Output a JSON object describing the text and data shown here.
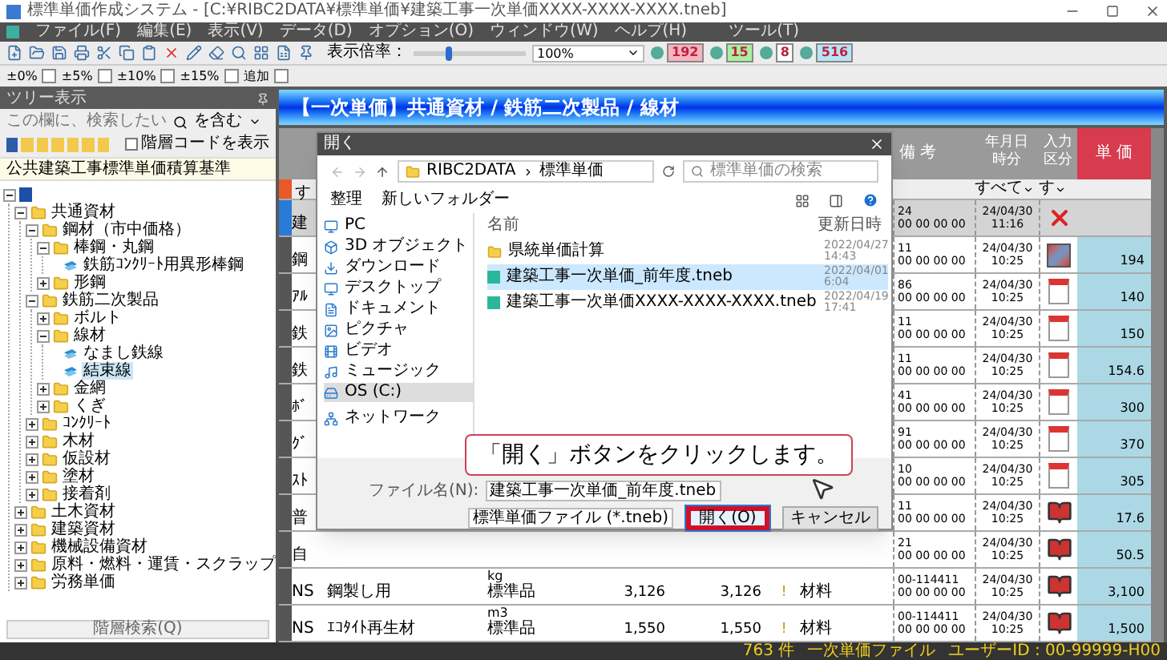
{
  "window": {
    "title": "標準単価作成システム - [C:¥RIBC2DATA¥標準単価¥建築工事一次単価XXXX-XXXX-XXXX.tneb]"
  },
  "menu": [
    "ファイル(F)",
    "編集(E)",
    "表示(V)",
    "データ(D)",
    "オプション(O)",
    "ウィンドウ(W)",
    "ヘルプ(H)",
    "ツール(T)"
  ],
  "toolbar": {
    "zoom_label": "表示倍率：",
    "zoom": {
      "level": 0.3
    },
    "zoom_value": "100%",
    "counters": [
      {
        "value": "192",
        "color": "#f6b3c0"
      },
      {
        "value": "15",
        "color": "#a8f0a0"
      },
      {
        "value": "8",
        "color": "#ffffff"
      },
      {
        "value": "516",
        "color": "#b8e4f8"
      }
    ]
  },
  "percent_bar": [
    "±0%",
    "±5%",
    "±10%",
    "±15%",
    "追加"
  ],
  "tree_panel": {
    "title": "ツリー表示",
    "search_placeholder": "この欄に、検索したい",
    "match_mode": "を含む",
    "show_code": {
      "label": "階層コードを表示",
      "checked": false
    },
    "standard": "公共建築工事標準単価積算基準",
    "tree": [
      {
        "expanded": true,
        "children": [
          {
            "label": "共通資材",
            "expanded": true,
            "children": [
              {
                "label": "鋼材（市中価格）",
                "expanded": true,
                "children": [
                  {
                    "label": "棒鋼・丸鋼",
                    "expanded": true,
                    "children": [
                      {
                        "label": "鉄筋ｺﾝｸﾘｰﾄ用異形棒鋼",
                        "selected": false
                      }
                    ]
                  },
                  {
                    "label": "形鋼",
                    "expanded": false
                  }
                ]
              },
              {
                "label": "鉄筋二次製品",
                "expanded": true,
                "children": [
                  {
                    "label": "ボルト",
                    "expanded": false
                  },
                  {
                    "label": "線材",
                    "expanded": true,
                    "children": [
                      {
                        "label": "なまし鉄線",
                        "selected": false
                      },
                      {
                        "label": "結束線",
                        "selected": true
                      }
                    ]
                  },
                  {
                    "label": "金網",
                    "expanded": false
                  },
                  {
                    "label": "くぎ",
                    "expanded": false
                  }
                ]
              },
              {
                "label": "ｺﾝｸﾘｰﾄ",
                "expanded": false
              },
              {
                "label": "木材",
                "expanded": false
              },
              {
                "label": "仮設材",
                "expanded": false
              },
              {
                "label": "塗材",
                "expanded": false
              },
              {
                "label": "接着剤",
                "expanded": false
              }
            ]
          },
          {
            "label": "土木資材",
            "expanded": false
          },
          {
            "label": "建築資材",
            "expanded": false
          },
          {
            "label": "機械設備資材",
            "expanded": false
          },
          {
            "label": "原料・燃料・運賃・スクラップ",
            "expanded": false
          },
          {
            "label": "労務単価",
            "expanded": false
          }
        ]
      }
    ],
    "search_button": "階層検索(Q)"
  },
  "banner": "【一次単価】共通資材 / 鉄筋二次製品 / 線材",
  "grid": {
    "headers": [
      [
        "備 考"
      ],
      [
        "年月日",
        "時分"
      ],
      [
        "入力",
        "区分"
      ],
      [
        "単 価"
      ]
    ],
    "filters": [
      "す",
      "すべて",
      "す"
    ],
    "rows": [
      {
        "name": "建",
        "code": "24",
        "remarks": "00 00 00 00",
        "date": "24/04/30",
        "time": "11:16",
        "kind": "deleted",
        "selected": true
      },
      {
        "name": "鋼",
        "code": "11",
        "remarks": "00 00 00 00",
        "date": "24/04/30",
        "time": "10:25",
        "kind": "edited",
        "price": "194",
        "selected": false
      },
      {
        "name": "ｱﾙ",
        "code": "86",
        "remarks": "00 00 00 00",
        "date": "24/04/30",
        "time": "10:25",
        "kind": "document",
        "price": "140",
        "selected": false
      },
      {
        "name": "鉄",
        "code": "11",
        "remarks": "00 00 00 00",
        "date": "24/04/30",
        "time": "10:25",
        "kind": "document",
        "price": "150",
        "selected": false
      },
      {
        "name": "鉄",
        "code": "11",
        "remarks": "00 00 00 00",
        "date": "24/04/30",
        "time": "10:25",
        "kind": "document",
        "price": "154.6",
        "selected": false
      },
      {
        "name": "ﾎﾞ",
        "code": "41",
        "remarks": "00 00 00 00",
        "date": "24/04/30",
        "time": "10:25",
        "kind": "document",
        "price": "300",
        "selected": false
      },
      {
        "name": "ｸﾞ",
        "code": "91",
        "remarks": "00 00 00 00",
        "date": "24/04/30",
        "time": "10:25",
        "kind": "document",
        "price": "370",
        "selected": false
      },
      {
        "name": "ｽﾄ",
        "code": "10",
        "remarks": "00 00 00 00",
        "date": "24/04/30",
        "time": "10:25",
        "kind": "document",
        "price": "305",
        "selected": false
      },
      {
        "name": "普",
        "code": "11",
        "remarks": "00 00 00 00",
        "date": "24/04/30",
        "time": "10:25",
        "kind": "book",
        "price": "17.6",
        "selected": false
      },
      {
        "name": "自",
        "code": "21",
        "remarks": "00 00 00 00",
        "date": "24/04/30",
        "time": "10:25",
        "kind": "book",
        "price": "50.5",
        "selected": false
      },
      {
        "name": "NS",
        "spec": "鋼製し用",
        "unit": "kg",
        "grade": "標準品",
        "p1": "3,126",
        "p2": "3,126",
        "flag": "!",
        "category": "材料",
        "code": "00-114411",
        "remarks": "00 00 00 00",
        "date": "24/04/30",
        "time": "10:25",
        "kind": "book",
        "price": "3,100",
        "selected": false
      },
      {
        "name": "NS",
        "spec": "ｴｺﾀｲﾄ再生材",
        "unit": "m3",
        "grade": "標準品",
        "p1": "1,550",
        "p2": "1,550",
        "flag": "!",
        "category": "材料",
        "code": "00-114411",
        "remarks": "00 00 00 00",
        "date": "24/04/30",
        "time": "10:25",
        "kind": "book",
        "price": "1,500",
        "selected": false
      }
    ]
  },
  "dialog": {
    "title": "開く",
    "path": [
      "RIBC2DATA",
      "標準単価"
    ],
    "search_placeholder": "標準単価の検索",
    "organize": "整理",
    "new_folder": "新しいフォルダー",
    "nav": [
      {
        "label": "PC",
        "kind": "pc"
      },
      {
        "label": "3D オブジェクト",
        "kind": "cube"
      },
      {
        "label": "ダウンロード",
        "kind": "download"
      },
      {
        "label": "デスクトップ",
        "kind": "desktop"
      },
      {
        "label": "ドキュメント",
        "kind": "document"
      },
      {
        "label": "ピクチャ",
        "kind": "picture"
      },
      {
        "label": "ビデオ",
        "kind": "video"
      },
      {
        "label": "ミュージック",
        "kind": "music"
      },
      {
        "label": "OS (C:)",
        "kind": "drive",
        "selected": true
      },
      {
        "label": "ネットワーク",
        "kind": "network"
      }
    ],
    "columns": [
      "名前",
      "更新日時"
    ],
    "files": [
      {
        "name": "県統単価計算",
        "date": "2022/04/27 14:43",
        "kind": "folder",
        "selected": false
      },
      {
        "name": "建築工事一次単価_前年度.tneb",
        "date": "2022/04/01 6:04",
        "kind": "file",
        "selected": true
      },
      {
        "name": "建築工事一次単価XXXX-XXXX-XXXX.tneb",
        "date": "2022/04/19 17:41",
        "kind": "file",
        "selected": false
      }
    ],
    "filename_label": "ファイル名(N):",
    "filename": "建築工事一次単価_前年度.tneb",
    "filter": "標準単価ファイル (*.tneb)",
    "open": "開く(O)",
    "cancel": "キャンセル"
  },
  "callout": "「開く」ボタンをクリックします。",
  "status": [
    "763 件",
    "一次単価ファイル",
    "ユーザーID : 00-99999-H00"
  ]
}
